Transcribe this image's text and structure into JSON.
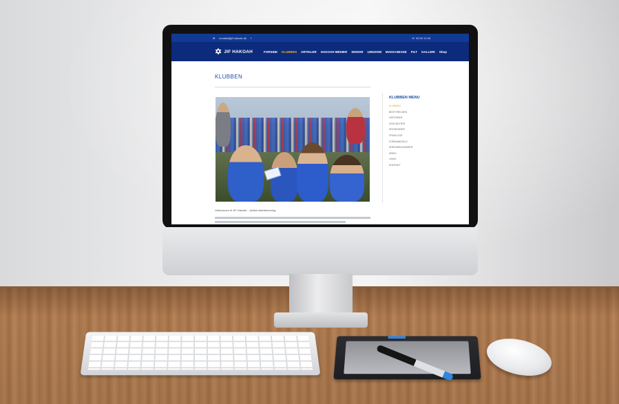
{
  "site": {
    "topbar": {
      "email": "kontakt@jif-hakoah.dk",
      "social_icon": "facebook-icon",
      "phone_icon": "phone-icon",
      "phone": "35 55 13 96"
    },
    "logo_text": "JIF HAKOAH",
    "menu": [
      {
        "label": "FORSIDE"
      },
      {
        "label": "KLUBBEN",
        "active": true
      },
      {
        "label": "ARTIKLER"
      },
      {
        "label": "HAKOAH MEDIER"
      },
      {
        "label": "SENIOR"
      },
      {
        "label": "UNGDOM"
      },
      {
        "label": "MAKKABIADE"
      },
      {
        "label": "FILT"
      },
      {
        "label": "GALLERI"
      },
      {
        "label": "Shop"
      }
    ],
    "page_title": "KLUBBEN",
    "caption": "Velkommen til JIF Hakoah - Jødisk idrætsforening",
    "sidebar": {
      "title": "KLUBBEN MENU",
      "items": [
        {
          "label": "KLUBBEN",
          "current": true
        },
        {
          "label": "BESTYRELSEN"
        },
        {
          "label": "HISTORIEN"
        },
        {
          "label": "VEDTÆGTER"
        },
        {
          "label": "SPONSORER"
        },
        {
          "label": "FRIVILLIGE"
        },
        {
          "label": "FORENINGSLIV"
        },
        {
          "label": "ÆRESMEDLEMMER"
        },
        {
          "label": "ARKIV"
        },
        {
          "label": "LINKS"
        },
        {
          "label": "KONTAKT"
        }
      ]
    }
  },
  "colors": {
    "navbar": "#0c2b7c",
    "topbar": "#113a94",
    "accent": "#f2b01e",
    "title": "#1e4ea6"
  }
}
